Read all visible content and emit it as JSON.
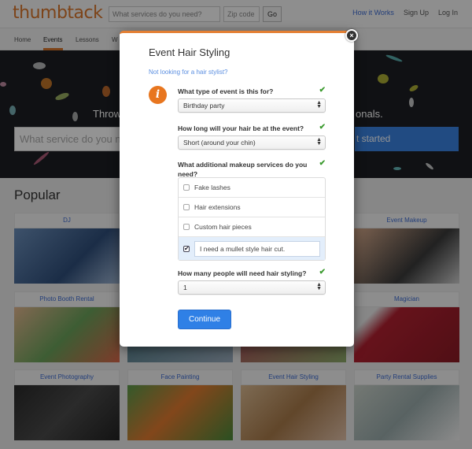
{
  "header": {
    "logo": "thumbtack",
    "search_placeholder": "What services do you need?",
    "zip_placeholder": "Zip code",
    "go_label": "Go",
    "links": [
      "How it Works",
      "Sign Up",
      "Log In"
    ]
  },
  "subnav": {
    "items": [
      "Home",
      "Events",
      "Lessons",
      "W"
    ],
    "active": "Events"
  },
  "hero": {
    "tagline_start": "Throw",
    "tagline_end": "onals.",
    "input_placeholder": "What service do you n",
    "button_label": "t started"
  },
  "popular": {
    "title": "Popular",
    "tiles": [
      {
        "label": "DJ"
      },
      {
        "label": ""
      },
      {
        "label": ""
      },
      {
        "label": "Event Makeup"
      },
      {
        "label": "Photo Booth Rental"
      },
      {
        "label": ""
      },
      {
        "label": ""
      },
      {
        "label": "Magician"
      },
      {
        "label": "Event Photography"
      },
      {
        "label": "Face Painting"
      },
      {
        "label": "Event Hair Styling"
      },
      {
        "label": "Party Rental Supplies"
      }
    ]
  },
  "modal": {
    "title": "Event Hair Styling",
    "alt_link": "Not looking for a hair stylist?",
    "info_icon": "i",
    "close_icon": "×",
    "questions": [
      {
        "label": "What type of event is this for?",
        "value": "Birthday party",
        "answered": true
      },
      {
        "label": "How long will your hair be at the event?",
        "value": "Short (around your chin)",
        "answered": true
      },
      {
        "label": "What additional makeup services do you need?",
        "answered": true,
        "options": [
          {
            "label": "Fake lashes",
            "checked": false
          },
          {
            "label": "Hair extensions",
            "checked": false
          },
          {
            "label": "Custom hair pieces",
            "checked": false
          }
        ],
        "other": {
          "checked": true,
          "value": "I need a mullet style hair cut."
        }
      },
      {
        "label": "How many people will need hair styling?",
        "value": "1",
        "answered": true
      }
    ],
    "continue_label": "Continue"
  },
  "colors": {
    "brand_orange": "#e47f33",
    "primary_blue": "#2f80e6",
    "check_green": "#3b9a2e",
    "link_blue": "#3d6bd1"
  }
}
